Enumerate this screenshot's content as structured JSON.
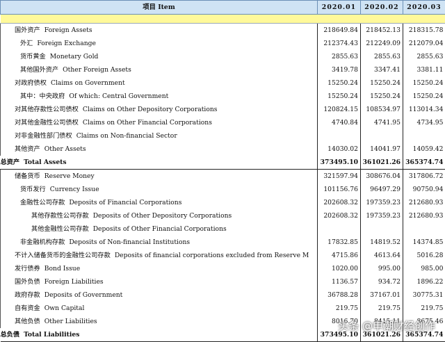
{
  "header": {
    "item": "项目 Item",
    "columns": [
      "2020.01",
      "2020.02",
      "2020.03"
    ]
  },
  "rows": [
    {
      "zh": "国外资产",
      "en": "Foreign Assets",
      "indent": 1,
      "values": [
        "218649.84",
        "218452.13",
        "218315.78"
      ]
    },
    {
      "zh": "外汇",
      "en": "Foreign Exchange",
      "indent": 2,
      "values": [
        "212374.43",
        "212249.09",
        "212079.04"
      ]
    },
    {
      "zh": "货币黄金",
      "en": "Monetary Gold",
      "indent": 2,
      "values": [
        "2855.63",
        "2855.63",
        "2855.63"
      ]
    },
    {
      "zh": "其他国外资产",
      "en": "Other Foreign Assets",
      "indent": 2,
      "values": [
        "3419.78",
        "3347.41",
        "3381.11"
      ]
    },
    {
      "zh": "对政府债权",
      "en": "Claims on Government",
      "indent": 1,
      "values": [
        "15250.24",
        "15250.24",
        "15250.24"
      ]
    },
    {
      "zh": "其中：中央政府",
      "en": "Of which: Central Government",
      "indent": 2,
      "values": [
        "15250.24",
        "15250.24",
        "15250.24"
      ]
    },
    {
      "zh": "对其他存款性公司债权",
      "en": "Claims on Other Depository Corporations",
      "indent": 1,
      "values": [
        "120824.15",
        "108534.97",
        "113014.34"
      ]
    },
    {
      "zh": "对其他金融性公司债权",
      "en": "Claims on Other Financial Corporations",
      "indent": 1,
      "values": [
        "4740.84",
        "4741.95",
        "4734.95"
      ]
    },
    {
      "zh": "对非金融性部门债权",
      "en": "Claims on Non-financial Sector",
      "indent": 1,
      "values": [
        "",
        "",
        ""
      ]
    },
    {
      "zh": "其他资产",
      "en": "Other Assets",
      "indent": 1,
      "values": [
        "14030.02",
        "14041.97",
        "14059.42"
      ]
    },
    {
      "zh": "总资产",
      "en": "Total Assets",
      "indent": 0,
      "total": true,
      "values": [
        "373495.10",
        "361021.26",
        "365374.74"
      ]
    },
    {
      "zh": "储备货币",
      "en": "Reserve Money",
      "indent": 1,
      "values": [
        "321597.94",
        "308676.04",
        "317806.72"
      ]
    },
    {
      "zh": "货币发行",
      "en": "Currency Issue",
      "indent": 2,
      "values": [
        "101156.76",
        "96497.29",
        "90750.94"
      ]
    },
    {
      "zh": "金融性公司存款",
      "en": "Deposits of Financial Corporations",
      "indent": 2,
      "values": [
        "202608.32",
        "197359.23",
        "212680.93"
      ]
    },
    {
      "zh": "其他存款性公司存款",
      "en": "Deposits of Other Depository Corporations",
      "indent": 3,
      "values": [
        "202608.32",
        "197359.23",
        "212680.93"
      ]
    },
    {
      "zh": "其他金融性公司存款",
      "en": "Deposits of Other Financial Corporations",
      "indent": 3,
      "values": [
        "",
        "",
        ""
      ]
    },
    {
      "zh": "非金融机构存款",
      "en": "Deposits of Non-financial Institutions",
      "indent": 2,
      "values": [
        "17832.85",
        "14819.52",
        "14374.85"
      ]
    },
    {
      "zh": "不计入储备货币的金融性公司存款",
      "en": "Deposits of financial corporations excluded from Reserve M",
      "indent": 1,
      "values": [
        "4715.86",
        "4613.64",
        "5016.28"
      ]
    },
    {
      "zh": "发行债券",
      "en": "Bond Issue",
      "indent": 1,
      "values": [
        "1020.00",
        "995.00",
        "985.00"
      ]
    },
    {
      "zh": "国外负债",
      "en": "Foreign Liabilities",
      "indent": 1,
      "values": [
        "1136.57",
        "934.72",
        "1896.22"
      ]
    },
    {
      "zh": "政府存款",
      "en": "Deposits of Government",
      "indent": 1,
      "values": [
        "36788.28",
        "37167.01",
        "30775.31"
      ]
    },
    {
      "zh": "自有资金",
      "en": "Own Capital",
      "indent": 1,
      "values": [
        "219.75",
        "219.75",
        "219.75"
      ]
    },
    {
      "zh": "其他负债",
      "en": "Other Liabilities",
      "indent": 1,
      "values": [
        "8016.70",
        "8415.11",
        "8675.46"
      ]
    },
    {
      "zh": "总负债",
      "en": "Total Liabilities",
      "indent": 0,
      "total": true,
      "values": [
        "373495.10",
        "361021.26",
        "365374.74"
      ]
    }
  ],
  "watermark": "头条 @申潮财经创作"
}
